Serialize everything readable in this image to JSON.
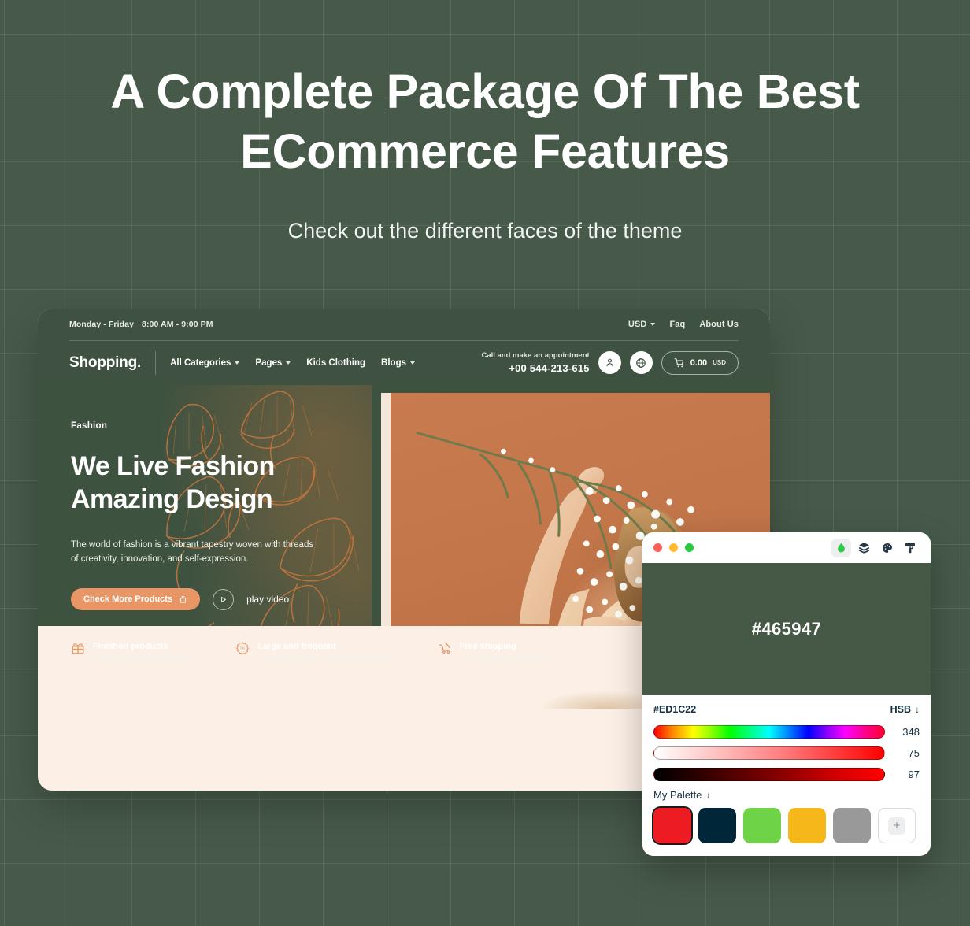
{
  "hero": {
    "title": "A Complete Package Of The Best ECommerce Features",
    "subtitle": "Check out the different faces of the theme"
  },
  "site_preview": {
    "topbar": {
      "hours_label": "Monday - Friday",
      "hours_value": "8:00 AM - 9:00 PM",
      "currency": "USD",
      "links": [
        "Faq",
        "About Us"
      ]
    },
    "nav": {
      "brand": "Shopping.",
      "items": [
        {
          "label": "All Categories",
          "has_dropdown": true
        },
        {
          "label": "Pages",
          "has_dropdown": true
        },
        {
          "label": "Kids Clothing",
          "has_dropdown": false
        },
        {
          "label": "Blogs",
          "has_dropdown": true
        }
      ],
      "appointment_label": "Call and make an appointment",
      "phone": "+00 544-213-615",
      "cart_amount": "0.00",
      "cart_currency": "USD",
      "account_icon": "user-icon",
      "language_icon": "globe-icon",
      "cart_icon": "cart-icon"
    },
    "slide": {
      "eyebrow": "Fashion",
      "title_line1": "We Live Fashion",
      "title_line2": "Amazing Design",
      "description": "The world of fashion is a vibrant tapestry woven with threads of creativity, innovation, and self-expression.",
      "primary_button": "Check More Products",
      "primary_button_icon": "bag-icon",
      "play_label": "play video",
      "play_icon": "play-icon"
    },
    "features": [
      {
        "icon": "gift-icon",
        "title": "Finished products",
        "subtitle": "products and gift wrapping"
      },
      {
        "icon": "discount-badge-icon",
        "title": "Large and frequent",
        "subtitle": "promotions with numerous discounts"
      },
      {
        "icon": "shipping-cart-icon",
        "title": "Free shipping",
        "subtitle": "on any order from $ 150"
      }
    ]
  },
  "color_picker": {
    "window_controls": [
      {
        "name": "close",
        "color": "#FF5F57"
      },
      {
        "name": "minimize",
        "color": "#FEBC2E"
      },
      {
        "name": "zoom",
        "color": "#28C840"
      }
    ],
    "tools": [
      {
        "icon": "droplet-icon",
        "active": true
      },
      {
        "icon": "layers-icon",
        "active": false
      },
      {
        "icon": "palette-icon",
        "active": false
      },
      {
        "icon": "paint-roller-icon",
        "active": false
      }
    ],
    "preview_hex": "#465947",
    "current_hex": "#ED1C22",
    "mode": "HSB",
    "mode_arrow": "↓",
    "sliders": [
      {
        "channel": "hue",
        "value": "348"
      },
      {
        "channel": "saturation",
        "value": "75"
      },
      {
        "channel": "brightness",
        "value": "97"
      }
    ],
    "palette_label": "My Palette",
    "palette_arrow": "↓",
    "palette_swatches": [
      {
        "color": "#ED1C22",
        "selected": true
      },
      {
        "color": "#002639",
        "selected": false
      },
      {
        "color": "#6ED347",
        "selected": false
      },
      {
        "color": "#F5B719",
        "selected": false
      },
      {
        "color": "#999999",
        "selected": false
      }
    ],
    "add_swatch_label": "+"
  },
  "theme": {
    "background": "#475A49",
    "site_green": "#3F5241",
    "accent_orange": "#E89666",
    "cream": "#FCF0E6",
    "terracotta": "#C2764A"
  }
}
